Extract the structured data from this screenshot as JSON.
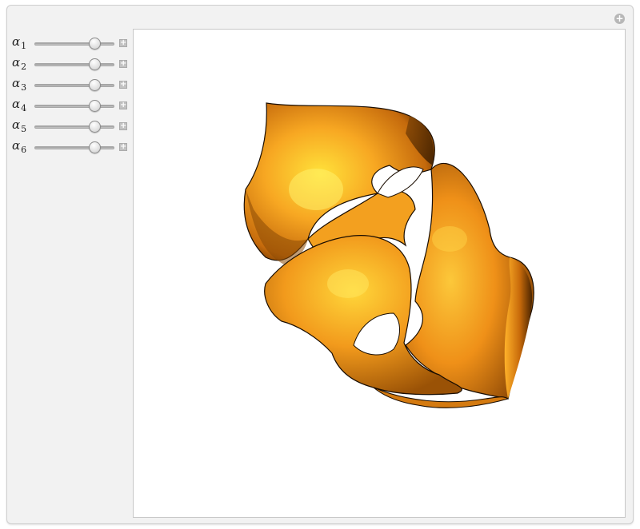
{
  "manipulate": {
    "options_icon": "plus-circle-icon",
    "controls": [
      {
        "symbol": "α",
        "index": "1",
        "value_fraction": 0.75
      },
      {
        "symbol": "α",
        "index": "2",
        "value_fraction": 0.75
      },
      {
        "symbol": "α",
        "index": "3",
        "value_fraction": 0.75
      },
      {
        "symbol": "α",
        "index": "4",
        "value_fraction": 0.75
      },
      {
        "symbol": "α",
        "index": "5",
        "value_fraction": 0.75
      },
      {
        "symbol": "α",
        "index": "6",
        "value_fraction": 0.75
      }
    ],
    "increment_icon": "plus-square-icon"
  },
  "graphic": {
    "type": "3d-surface-plot",
    "surface_color": "#f59a1c",
    "highlight_color": "#ffe23a",
    "shadow_color": "#5a3000",
    "background": "#ffffff"
  }
}
